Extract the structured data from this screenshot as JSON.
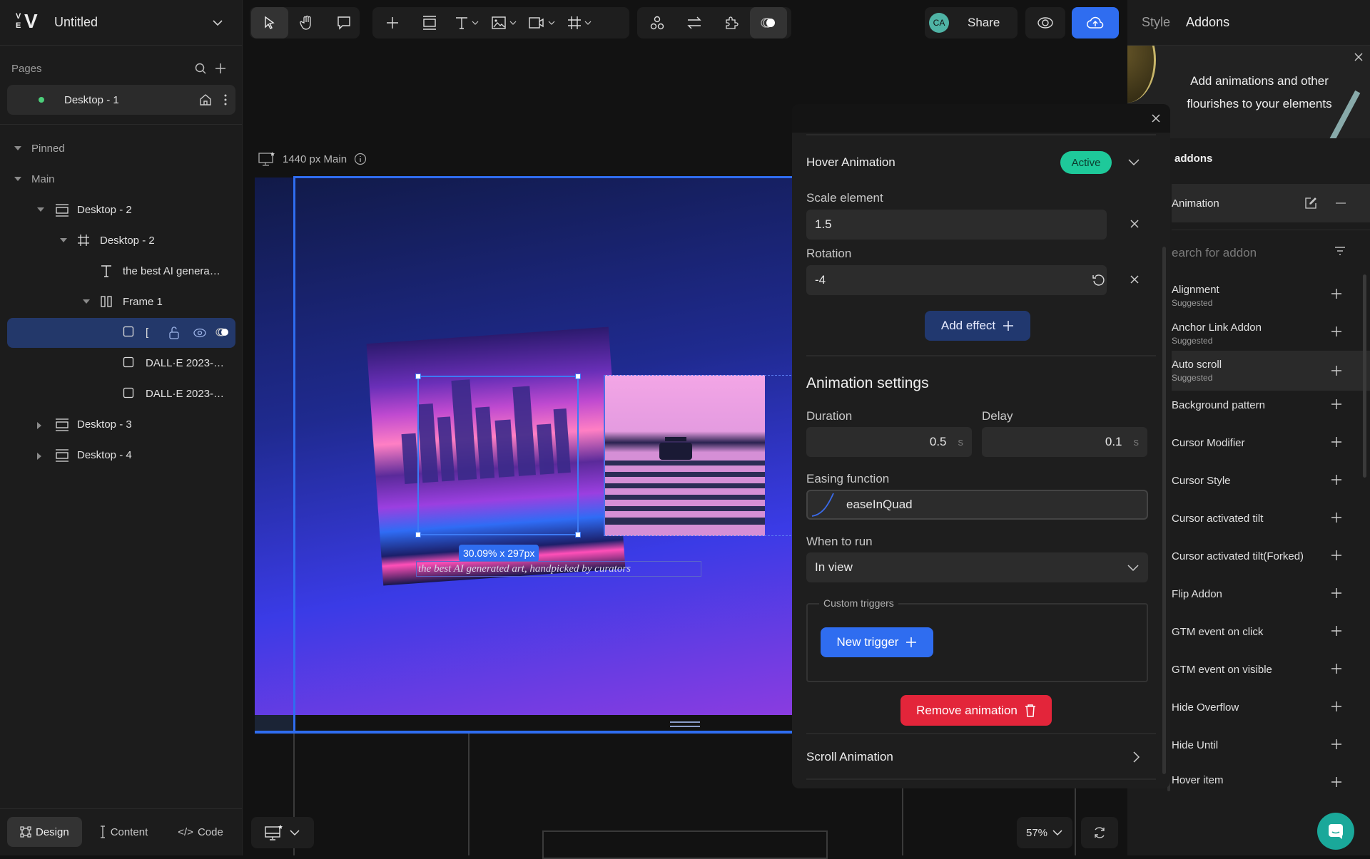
{
  "app": {
    "project_title": "Untitled"
  },
  "left_sidebar": {
    "pages_label": "Pages",
    "pages": [
      {
        "name": "Desktop - 1",
        "status_color": "#4ccf7a",
        "is_home": true
      }
    ],
    "tree": [
      {
        "label": "Pinned",
        "depth": 0,
        "expanded": true,
        "icon": "none"
      },
      {
        "label": "Main",
        "depth": 0,
        "expanded": true,
        "icon": "none"
      },
      {
        "label": "Desktop - 2",
        "depth": 1,
        "expanded": true,
        "icon": "breakpoint-icon"
      },
      {
        "label": "Desktop - 2",
        "depth": 2,
        "expanded": true,
        "icon": "frame-icon"
      },
      {
        "label": "the best AI genera…",
        "depth": 3,
        "icon": "text-icon"
      },
      {
        "label": "Frame 1",
        "depth": 3,
        "expanded": true,
        "icon": "columns-icon"
      },
      {
        "label": "[",
        "depth": 4,
        "icon": "box-icon",
        "selected": true
      },
      {
        "label": "DALL·E 2023-…",
        "depth": 4,
        "icon": "box-icon"
      },
      {
        "label": "DALL·E 2023-…",
        "depth": 4,
        "icon": "box-icon"
      },
      {
        "label": "Desktop - 3",
        "depth": 1,
        "expanded": false,
        "icon": "breakpoint-icon"
      },
      {
        "label": "Desktop - 4",
        "depth": 1,
        "expanded": false,
        "icon": "breakpoint-icon"
      }
    ],
    "bottom_tabs": [
      {
        "label": "Design",
        "active": true
      },
      {
        "label": "Content",
        "active": false
      },
      {
        "label": "Code",
        "active": false
      }
    ]
  },
  "toolbar": {
    "share_label": "Share",
    "avatar_initials": "CA",
    "avatar_color": "#4fb3a5",
    "publish_color": "#2f6df0"
  },
  "canvas": {
    "breakpoint_label": "1440 px Main",
    "size_badge": "30.09% x 297px",
    "caption_text": "the best AI generated art, handpicked by curators",
    "zoom_level": "57%"
  },
  "right_panel": {
    "tabs": [
      {
        "label": "Style",
        "active": false
      },
      {
        "label": "Addons",
        "active": true
      }
    ],
    "banner_text": "Add animations and other flourishes to your elements",
    "section_title": "addons",
    "installed": [
      {
        "name": "Animation"
      }
    ],
    "search_placeholder": "earch for addon",
    "addons": [
      {
        "name": "Alignment",
        "sub": "Suggested"
      },
      {
        "name": "Anchor Link Addon",
        "sub": "Suggested"
      },
      {
        "name": "Auto scroll",
        "sub": "Suggested",
        "hovered": true
      },
      {
        "name": "Background pattern"
      },
      {
        "name": "Cursor Modifier"
      },
      {
        "name": "Cursor Style"
      },
      {
        "name": "Cursor activated tilt"
      },
      {
        "name": "Cursor activated tilt(Forked)"
      },
      {
        "name": "Flip Addon"
      },
      {
        "name": "GTM event on click"
      },
      {
        "name": "GTM event on visible"
      },
      {
        "name": "Hide Overflow"
      },
      {
        "name": "Hide Until"
      },
      {
        "name": "Hover item"
      }
    ]
  },
  "animation_panel": {
    "hover": {
      "title": "Hover Animation",
      "status": "Active",
      "status_color": "#1ec99a",
      "scale_label": "Scale element",
      "scale_value": "1.5",
      "rotation_label": "Rotation",
      "rotation_value": "-4",
      "add_effect_label": "Add effect"
    },
    "settings": {
      "title": "Animation settings",
      "duration_label": "Duration",
      "duration_value": "0.5",
      "duration_unit": "s",
      "delay_label": "Delay",
      "delay_value": "0.1",
      "delay_unit": "s",
      "easing_label": "Easing function",
      "easing_value": "easeInQuad",
      "when_label": "When to run",
      "when_value": "In view",
      "custom_triggers_label": "Custom triggers",
      "new_trigger_label": "New trigger",
      "remove_label": "Remove animation",
      "remove_color": "#e3253a"
    },
    "scroll": {
      "title": "Scroll Animation"
    }
  }
}
